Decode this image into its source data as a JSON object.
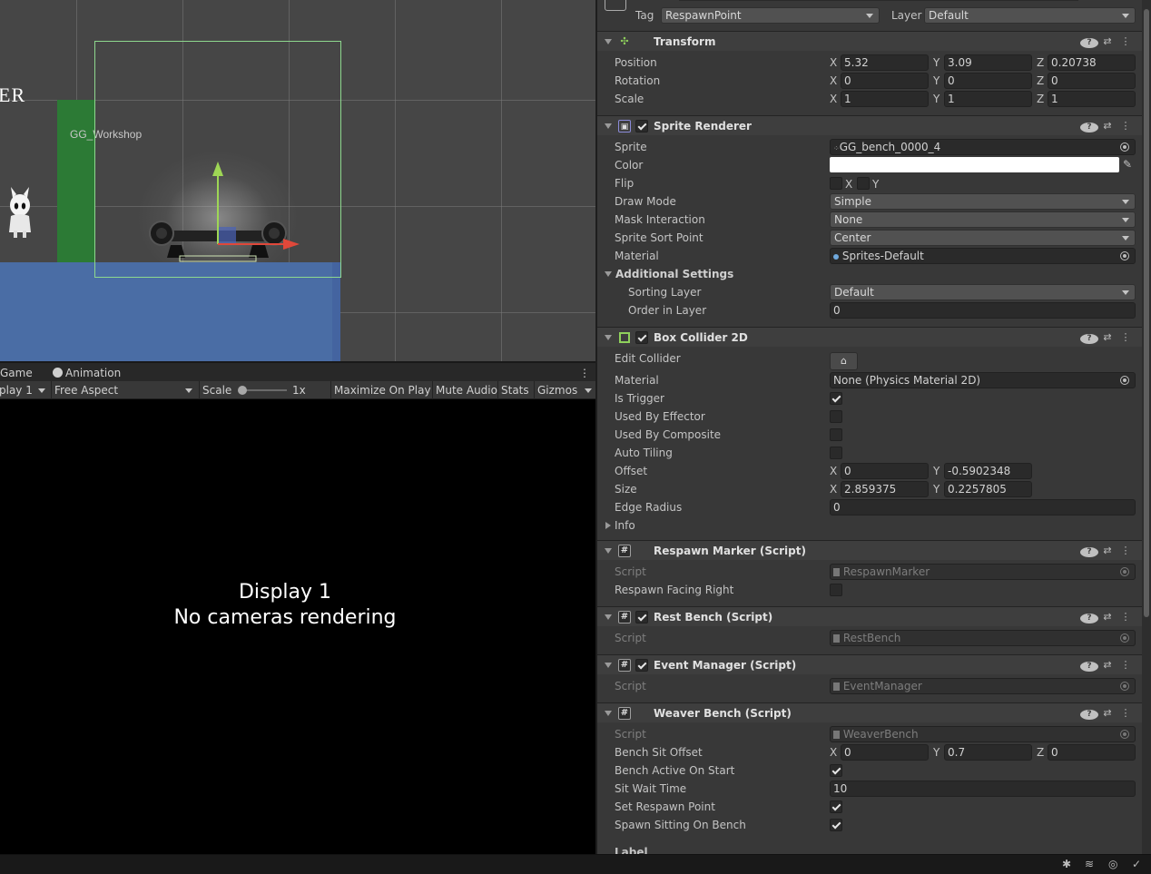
{
  "scene": {
    "side_text": "ER",
    "object_label": "GG_Workshop"
  },
  "game": {
    "tabs": [
      "Game",
      "Animation"
    ],
    "display_select": "play 1",
    "aspect": "Free Aspect",
    "scale_label": "Scale",
    "scale_value": "1x",
    "maximize": "Maximize On Play",
    "mute": "Mute Audio",
    "stats": "Stats",
    "gizmos": "Gizmos",
    "message_line1": "Display 1",
    "message_line2": "No cameras rendering"
  },
  "inspector": {
    "tag_label": "Tag",
    "tag_value": "RespawnPoint",
    "layer_label": "Layer",
    "layer_value": "Default",
    "transform": {
      "title": "Transform",
      "position_label": "Position",
      "position": {
        "x": "5.32",
        "y": "3.09",
        "z": "0.20738"
      },
      "rotation_label": "Rotation",
      "rotation": {
        "x": "0",
        "y": "0",
        "z": "0"
      },
      "scale_label": "Scale",
      "scale": {
        "x": "1",
        "y": "1",
        "z": "1"
      }
    },
    "sprite_renderer": {
      "title": "Sprite Renderer",
      "sprite_label": "Sprite",
      "sprite": "GG_bench_0000_4",
      "color_label": "Color",
      "color": "#ffffff",
      "flip_label": "Flip",
      "flip_x": "X",
      "flip_y": "Y",
      "draw_mode_label": "Draw Mode",
      "draw_mode": "Simple",
      "mask_label": "Mask Interaction",
      "mask": "None",
      "sort_point_label": "Sprite Sort Point",
      "sort_point": "Center",
      "material_label": "Material",
      "material": "Sprites-Default",
      "additional": "Additional Settings",
      "sorting_layer_label": "Sorting Layer",
      "sorting_layer": "Default",
      "order_label": "Order in Layer",
      "order": "0"
    },
    "box_collider": {
      "title": "Box Collider 2D",
      "edit_label": "Edit Collider",
      "material_label": "Material",
      "material": "None (Physics Material 2D)",
      "trigger_label": "Is Trigger",
      "effector_label": "Used By Effector",
      "composite_label": "Used By Composite",
      "tiling_label": "Auto Tiling",
      "offset_label": "Offset",
      "offset": {
        "x": "0",
        "y": "-0.5902348"
      },
      "size_label": "Size",
      "size": {
        "x": "2.859375",
        "y": "0.2257805"
      },
      "radius_label": "Edge Radius",
      "radius": "0",
      "info_label": "Info"
    },
    "respawn_marker": {
      "title": "Respawn Marker (Script)",
      "script_label": "Script",
      "script": "RespawnMarker",
      "facing_label": "Respawn Facing Right"
    },
    "rest_bench": {
      "title": "Rest Bench (Script)",
      "script_label": "Script",
      "script": "RestBench"
    },
    "event_manager": {
      "title": "Event Manager (Script)",
      "script_label": "Script",
      "script": "EventManager"
    },
    "weaver_bench": {
      "title": "Weaver Bench (Script)",
      "script_label": "Script",
      "script": "WeaverBench",
      "sit_offset_label": "Bench Sit Offset",
      "sit_offset": {
        "x": "0",
        "y": "0.7",
        "z": "0"
      },
      "active_label": "Bench Active On Start",
      "wait_label": "Sit Wait Time",
      "wait": "10",
      "set_respawn_label": "Set Respawn Point",
      "spawn_sitting_label": "Spawn Sitting On Bench",
      "next_label": "Label"
    },
    "axis": {
      "x": "X",
      "y": "Y",
      "z": "Z"
    }
  }
}
